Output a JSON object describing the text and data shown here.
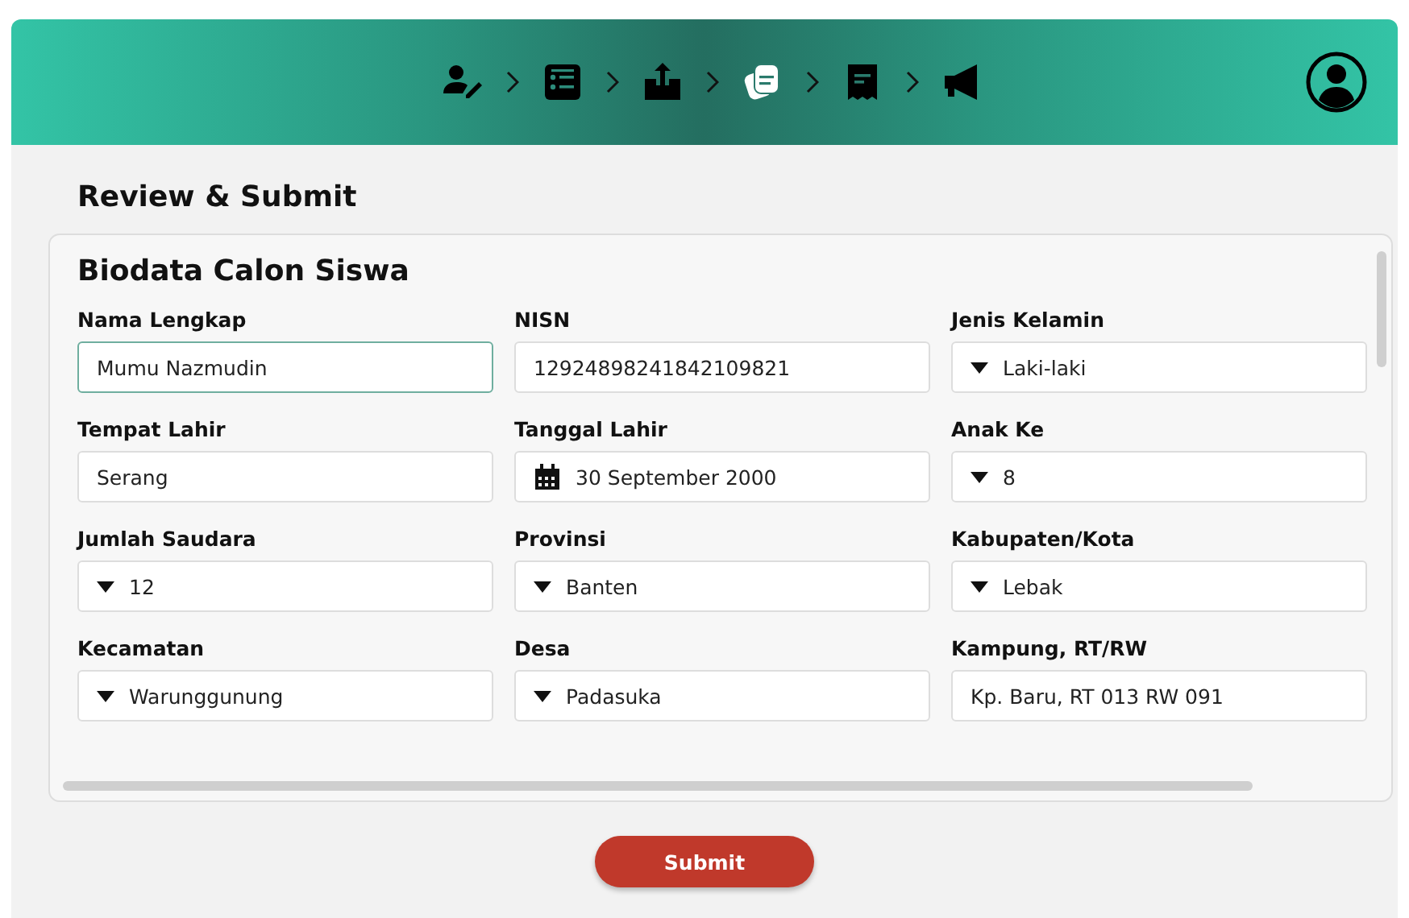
{
  "steps": [
    {
      "kind": "profile",
      "selected": false
    },
    {
      "kind": "form",
      "selected": false
    },
    {
      "kind": "upload",
      "selected": false
    },
    {
      "kind": "documents",
      "selected": true
    },
    {
      "kind": "receipt",
      "selected": false
    },
    {
      "kind": "announcement",
      "selected": false
    }
  ],
  "page_title": "Review & Submit",
  "card": {
    "title": "Biodata Calon Siswa",
    "fields": [
      {
        "label": "Nama Lengkap",
        "kind": "text",
        "value": "Mumu Nazmudin",
        "focused": true
      },
      {
        "label": "NISN",
        "kind": "text",
        "value": "12924898241842109821",
        "focused": false
      },
      {
        "label": "Jenis Kelamin",
        "kind": "select",
        "value": "Laki-laki",
        "focused": false
      },
      {
        "label": "Tempat Lahir",
        "kind": "text",
        "value": "Serang",
        "focused": false
      },
      {
        "label": "Tanggal Lahir",
        "kind": "date",
        "value": "30 September 2000",
        "focused": false
      },
      {
        "label": "Anak Ke",
        "kind": "select",
        "value": "8",
        "focused": false
      },
      {
        "label": "Jumlah Saudara",
        "kind": "select",
        "value": "12",
        "focused": false
      },
      {
        "label": "Provinsi",
        "kind": "select",
        "value": "Banten",
        "focused": false
      },
      {
        "label": "Kabupaten/Kota",
        "kind": "select",
        "value": "Lebak",
        "focused": false
      },
      {
        "label": "Kecamatan",
        "kind": "select",
        "value": "Warunggunung",
        "focused": false
      },
      {
        "label": "Desa",
        "kind": "select",
        "value": "Padasuka",
        "focused": false
      },
      {
        "label": "Kampung, RT/RW",
        "kind": "text",
        "value": "Kp. Baru, RT 013 RW 091",
        "focused": false
      }
    ]
  },
  "submit_button": "Submit"
}
